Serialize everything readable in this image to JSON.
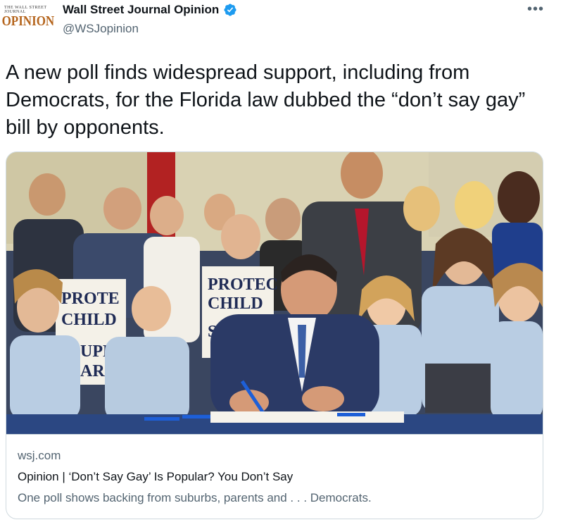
{
  "author": {
    "avatar_small_text": "THE WALL STREET JOURNAL",
    "avatar_logo_text": "OPINION",
    "display_name": "Wall Street Journal Opinion",
    "handle": "@WSJopinion",
    "verified_icon": "verified-badge-icon"
  },
  "more_icon": "more-options-icon",
  "more_label": "•••",
  "tweet": {
    "text": "A new poll finds widespread support, including from Democrats, for the Florida law dubbed the “don’t say gay” bill by opponents."
  },
  "card": {
    "image": {
      "sign_left_lines": [
        "PROTE",
        "CHILD",
        "UPP",
        "AR"
      ],
      "sign_right_lines": [
        "PROTEC",
        "CHILD",
        "S"
      ]
    },
    "domain": "wsj.com",
    "title": "Opinion | ‘Don’t Say Gay’ Is Popular? You Don’t Say",
    "description": "One poll shows backing from suburbs, parents and . . . Democrats."
  },
  "colors": {
    "verified": "#1d9bf0",
    "secondary_text": "#536471",
    "border": "#cfd9de"
  }
}
